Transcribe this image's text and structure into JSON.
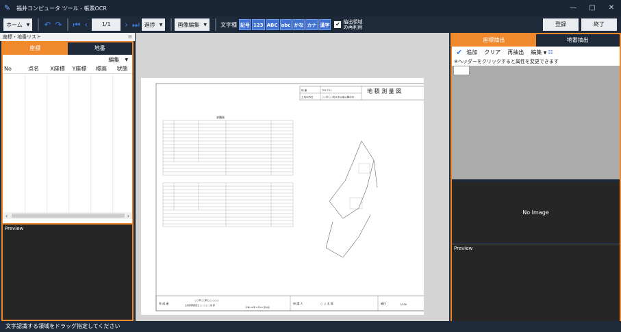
{
  "window": {
    "title": "福井コンピュータ ツール - 帳票OCR",
    "logo_icon": "pen-icon",
    "minimize": "—",
    "maximize": "□",
    "close": "✕"
  },
  "toolbar": {
    "home_label": "ホーム",
    "undo_icon": "undo-icon",
    "redo_icon": "redo-icon",
    "first_icon": "first-page-icon",
    "prev_icon": "prev-page-icon",
    "page_indicator": "1/1",
    "next_icon": "next-page-icon",
    "last_icon": "last-page-icon",
    "progress_label": "進捗",
    "image_edit_label": "画像編集",
    "char_type_label": "文字種",
    "char_chips": [
      "記号",
      "123",
      "ABC",
      "abc",
      "かな",
      "カナ",
      "漢字"
    ],
    "reuse_checkbox_checked": true,
    "reuse_label_line1": "抽出領域",
    "reuse_label_line2": "の再利用",
    "register_label": "登録",
    "exit_label": "終了"
  },
  "left_panel": {
    "header": "座標・地番リスト",
    "tabs": [
      "座標",
      "地番"
    ],
    "active_tab": 0,
    "edit_label": "編集",
    "columns": [
      "No",
      "点名",
      "X座標",
      "Y座標",
      "標高",
      "状態"
    ],
    "preview_label": "Preview"
  },
  "right_panel": {
    "tabs": [
      "座標抽出",
      "地番抽出"
    ],
    "active_tab": 0,
    "add_label": "追加",
    "clear_label": "クリア",
    "reextract_label": "再抽出",
    "edit_label": "編集",
    "note": "※ヘッダーをクリックすると属性を変更できます",
    "no_image": "No Image",
    "preview_label": "Preview"
  },
  "document": {
    "header_label1": "地  番",
    "header_value1": "T01 T01",
    "header_label2": "土地の所在",
    "header_value2": "○○市○○町大字以後以降中中",
    "doc_title": "地 積 測 量 図",
    "table_title": "求積表",
    "author_label": "作 成 者",
    "author_line1": "○○市○○町○○-○○○",
    "author_line2": "土地家屋調査士  □ □ □ □ 吉 郎",
    "date_text": "(平成 18 年 3 月 10 日作成)",
    "applicant_label": "申 請 人",
    "applicant_name": "○ ○ 太 郎",
    "scale_label": "縮尺",
    "scale_value": "1/200"
  },
  "status_bar": {
    "message": "文字認識する領域をドラッグ指定してください"
  },
  "colors": {
    "accent": "#f0882c",
    "chip_blue": "#3f72d2",
    "dark_bg": "#1e2a3a"
  }
}
